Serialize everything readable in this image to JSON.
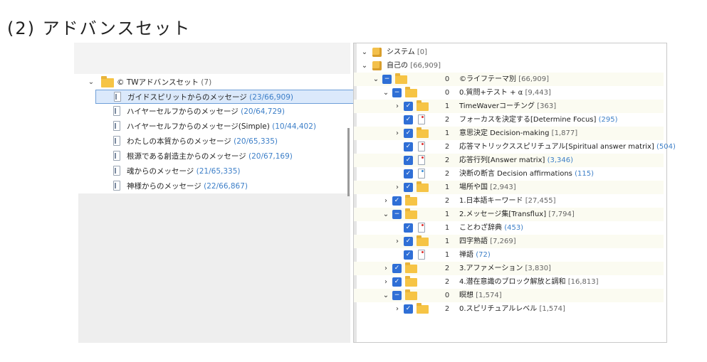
{
  "heading": "(2) アドバンスセット",
  "left_tree": {
    "root": {
      "label": "© TWアドバンスセット",
      "count": "(7)"
    },
    "items": [
      {
        "label": "ガイドスピリットからのメッセージ",
        "count": "(23/66,909)",
        "selected": true
      },
      {
        "label": "ハイヤーセルフからのメッセージ",
        "count": "(20/64,729)"
      },
      {
        "label": "ハイヤーセルフからのメッセージ(Simple)",
        "count": "(10/44,402)"
      },
      {
        "label": "わたしの本質からのメッセージ",
        "count": "(20/65,335)"
      },
      {
        "label": "根源である創造主からのメッセージ",
        "count": "(20/67,169)"
      },
      {
        "label": "魂からのメッセージ",
        "count": "(21/65,335)"
      },
      {
        "label": "神様からのメッセージ",
        "count": "(22/66,867)"
      }
    ]
  },
  "right_tree": {
    "rows": [
      {
        "label": "システム",
        "count": "[0]",
        "num": "",
        "countStyle": "gray"
      },
      {
        "label": "自己の",
        "count": "[66,909]",
        "num": "",
        "countStyle": "gray"
      },
      {
        "label": "©ライフテーマ別",
        "count": "[66,909]",
        "num": "0",
        "countStyle": "gray"
      },
      {
        "label": "0.質問+テスト + α",
        "count": "[9,443]",
        "num": "0",
        "countStyle": "gray"
      },
      {
        "label": "TimeWaverコーチング",
        "count": "[363]",
        "num": "1",
        "countStyle": "gray"
      },
      {
        "label": "フォーカスを決定する[Determine Focus]",
        "count": "(295)",
        "num": "2",
        "countStyle": "blue"
      },
      {
        "label": "意思決定 Decision-making",
        "count": "[1,877]",
        "num": "1",
        "countStyle": "gray"
      },
      {
        "label": "応答マトリックススピリチュアル[Spiritual answer matrix]",
        "count": "(504)",
        "num": "2",
        "countStyle": "blue"
      },
      {
        "label": "応答行列[Answer matrix]",
        "count": "(3,346)",
        "num": "2",
        "countStyle": "blue"
      },
      {
        "label": "決断の断言 Decision affirmations",
        "count": "(115)",
        "num": "2",
        "countStyle": "blue"
      },
      {
        "label": "場所や国",
        "count": "[2,943]",
        "num": "1",
        "countStyle": "gray"
      },
      {
        "label": "1.日本語キーワード",
        "count": "[27,455]",
        "num": "2",
        "countStyle": "gray"
      },
      {
        "label": "2.メッセージ集[Transflux]",
        "count": "[7,794]",
        "num": "1",
        "countStyle": "gray"
      },
      {
        "label": "ことわざ辞典",
        "count": "(453)",
        "num": "1",
        "countStyle": "blue"
      },
      {
        "label": "四字熟語",
        "count": "[7,269]",
        "num": "1",
        "countStyle": "gray"
      },
      {
        "label": "禅語",
        "count": "(72)",
        "num": "1",
        "countStyle": "blue"
      },
      {
        "label": "3.アファメーション",
        "count": "[3,830]",
        "num": "2",
        "countStyle": "gray"
      },
      {
        "label": "4.潜在意識のブロック解放と調和",
        "count": "[16,813]",
        "num": "2",
        "countStyle": "gray"
      },
      {
        "label": "瞑想",
        "count": "[1,574]",
        "num": "0",
        "countStyle": "gray"
      },
      {
        "label": "0.スピリチュアルレベル",
        "count": "[1,574]",
        "num": "2",
        "countStyle": "gray"
      }
    ]
  }
}
